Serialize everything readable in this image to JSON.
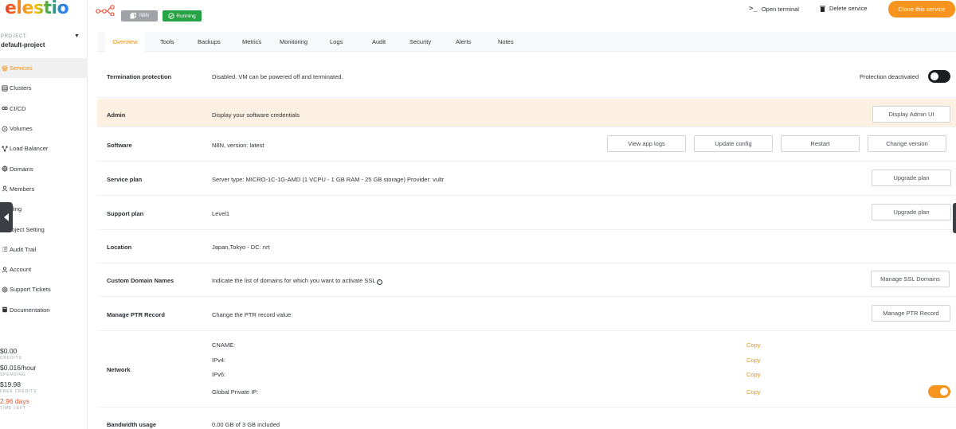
{
  "brand": {
    "logo_text": "elestio"
  },
  "sidebar": {
    "project_label": "PROJECT:",
    "project_name": "default-project",
    "items": [
      {
        "label": "Services",
        "icon": "layers-icon",
        "active": true
      },
      {
        "label": "Clusters",
        "icon": "database-icon"
      },
      {
        "label": "CI/CD",
        "icon": "infinity-icon"
      },
      {
        "label": "Volumes",
        "icon": "disk-icon"
      },
      {
        "label": "Load Balancer",
        "icon": "network-icon"
      },
      {
        "label": "Domains",
        "icon": "globe-icon"
      },
      {
        "label": "Members",
        "icon": "user-icon"
      },
      {
        "label": "illing",
        "icon": "card-icon"
      },
      {
        "label": "roject Setting",
        "icon": "gear-icon"
      },
      {
        "label": "Audit Trail",
        "icon": "list-icon"
      },
      {
        "label": "Account",
        "icon": "user-icon"
      },
      {
        "label": "Support Tickets",
        "icon": "lifebuoy-icon"
      },
      {
        "label": "Documentation",
        "icon": "book-icon"
      }
    ],
    "stats": [
      {
        "value": "$0.00",
        "label": "CREDITS"
      },
      {
        "value": "$0.016/hour",
        "label": "SPENDING"
      },
      {
        "value": "$19.98",
        "label": "FREE CREDITS"
      },
      {
        "value": "2.96 days",
        "label": "TIME LEFT",
        "warn": true
      }
    ]
  },
  "header": {
    "service_badge": "N8N",
    "status_badge": "Running",
    "open_terminal": "Open terminal",
    "delete_service": "Delete service",
    "clone_service": "Clone this service"
  },
  "tabs": [
    "Overview",
    "Tools",
    "Backups",
    "Metrics",
    "Monitoring",
    "Logs",
    "Audit",
    "Security",
    "Alerts",
    "Notes"
  ],
  "rows": {
    "termination": {
      "label": "Termination protection",
      "text": "Disabled. VM can be powered off and terminated.",
      "toggle_label": "Protection deactivated"
    },
    "admin": {
      "label": "Admin",
      "text": "Display your software credentials",
      "button": "Display Admin UI"
    },
    "software": {
      "label": "Software",
      "text": "N8N, version: latest",
      "buttons": [
        "View app logs",
        "Update config",
        "Restart",
        "Change version"
      ]
    },
    "service_plan": {
      "label": "Service plan",
      "text": "Server type: MICRO-1C-1G-AMD (1 VCPU - 1 GB RAM - 25 GB storage) Provider: vultr",
      "button": "Upgrade plan"
    },
    "support_plan": {
      "label": "Support plan",
      "text": "Level1",
      "button": "Upgrade plan"
    },
    "location": {
      "label": "Location",
      "text": "Japan,Tokyo - DC: nrt"
    },
    "custom_domains": {
      "label": "Custom Domain Names",
      "text": "Indicate the list of domains for which you want to activate SSL",
      "help": "?",
      "button": "Manage SSL Domains"
    },
    "ptr": {
      "label": "Manage PTR Record",
      "text": "Change the PTR record value",
      "button": "Manage PTR Record"
    },
    "network": {
      "label": "Network",
      "copy_label": "Copy",
      "lines": [
        "CNAME:",
        "IPv4:",
        "IPv6:",
        "Global Private IP:"
      ]
    },
    "bandwidth": {
      "label": "Bandwidth usage",
      "text": "0.00 GB of 3 GB included"
    }
  },
  "colors": {
    "accent": "#f7941d",
    "running": "#25a244",
    "highlight_row": "#fcf0e3"
  }
}
